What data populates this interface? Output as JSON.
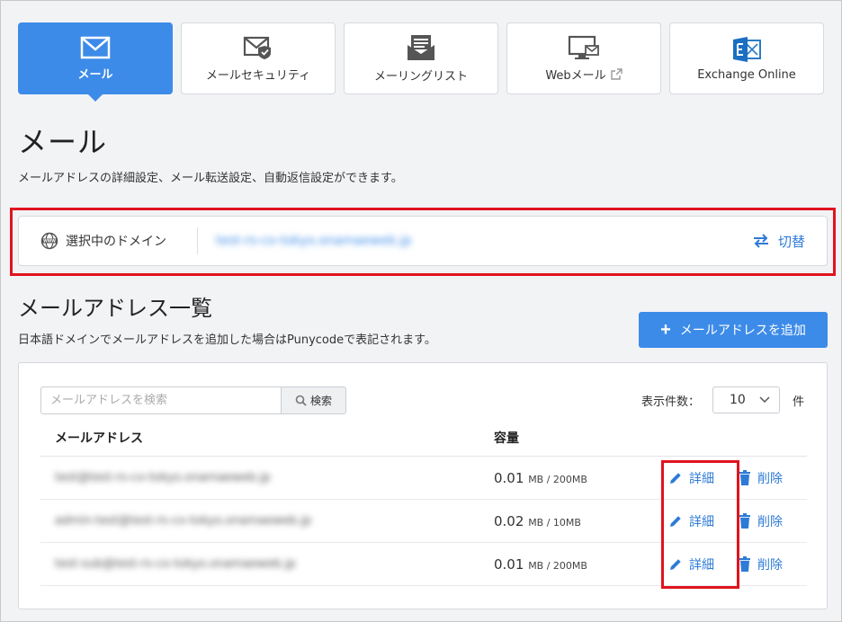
{
  "tabs": [
    {
      "label": "メール",
      "icon": "mail-icon",
      "active": true
    },
    {
      "label": "メールセキュリティ",
      "icon": "mail-security-icon"
    },
    {
      "label": "メーリングリスト",
      "icon": "mailing-list-icon"
    },
    {
      "label": "Webメール",
      "icon": "webmail-icon"
    },
    {
      "label": "Exchange Online",
      "icon": "exchange-icon"
    }
  ],
  "page": {
    "title": "メール",
    "description": "メールアドレスの詳細設定、メール転送設定、自動返信設定ができます。"
  },
  "domain": {
    "label": "選択中のドメイン",
    "value": "test-rs-co-tokyo.onamaeweb.jp",
    "switch_label": "切替"
  },
  "list": {
    "title": "メールアドレス一覧",
    "description": "日本語ドメインでメールアドレスを追加した場合はPunycodeで表記されます。",
    "add_label": "メールアドレスを追加"
  },
  "search": {
    "placeholder": "メールアドレスを検索",
    "button": "検索"
  },
  "per_page": {
    "label": "表示件数：",
    "value": "10",
    "unit": "件"
  },
  "table": {
    "headers": {
      "address": "メールアドレス",
      "capacity": "容量"
    },
    "rows": [
      {
        "address": "test@test-rs-co-tokyo.onamaeweb.jp",
        "used": "0.01",
        "unit_limit": "MB / 200MB",
        "edit": "詳細",
        "delete": "削除"
      },
      {
        "address": "admin-test@test-rs-co-tokyo.onamaeweb.jp",
        "used": "0.02",
        "unit_limit": "MB / 10MB",
        "edit": "詳細",
        "delete": "削除"
      },
      {
        "address": "test-sub@test-rs-co-tokyo.onamaeweb.jp",
        "used": "0.01",
        "unit_limit": "MB / 200MB",
        "edit": "詳細",
        "delete": "削除"
      }
    ]
  },
  "colors": {
    "accent": "#3d8be8",
    "link": "#2e7bd6",
    "highlight": "#e0141e"
  }
}
